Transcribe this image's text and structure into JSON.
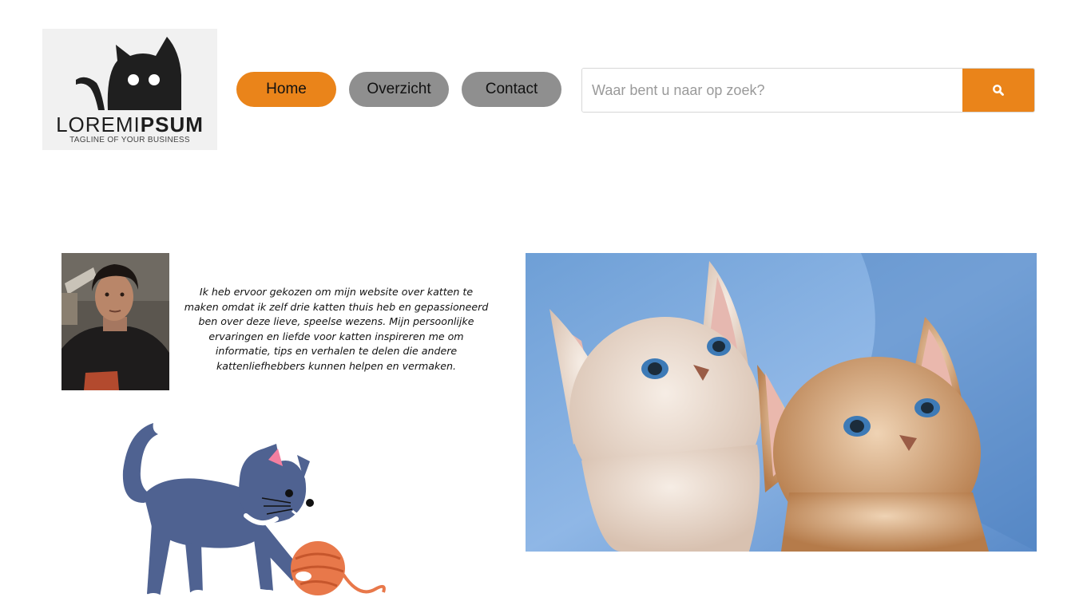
{
  "logo": {
    "brand_light": "LOREMI",
    "brand_bold": "PSUM",
    "tagline": "TAGLINE OF YOUR BUSINESS",
    "icon": "cat-logo-icon"
  },
  "nav": {
    "items": [
      {
        "label": "Home",
        "active": true
      },
      {
        "label": "Overzicht",
        "active": false
      },
      {
        "label": "Contact",
        "active": false
      }
    ]
  },
  "search": {
    "placeholder": "Waar bent u naar op zoek?",
    "value": "",
    "icon": "search-icon"
  },
  "about": {
    "text": "Ik heb ervoor gekozen om mijn website over katten te maken omdat ik zelf drie katten thuis heb en gepassioneerd ben over deze lieve, speelse wezens. Mijn persoonlijke ervaringen en liefde voor katten inspireren me om informatie, tips en verhalen te delen die andere kattenliefhebbers kunnen helpen en vermaken."
  },
  "colors": {
    "accent": "#ea841a",
    "nav_inactive": "#8f8f8f",
    "logo_bg": "#f1f1f1"
  }
}
